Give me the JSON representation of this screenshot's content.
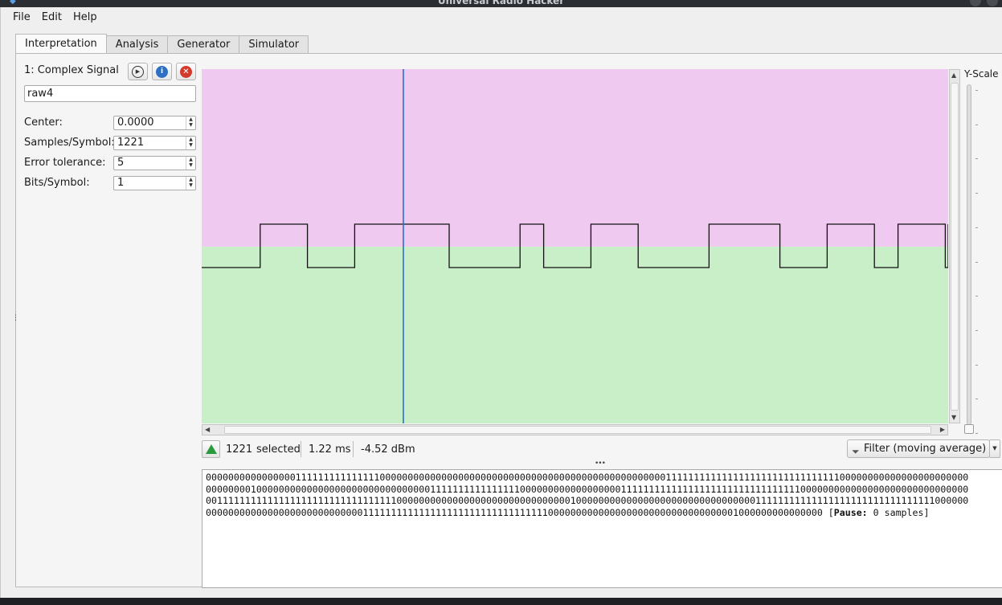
{
  "window": {
    "title": "Universal Radio Hacker"
  },
  "menu": {
    "file": "File",
    "edit": "Edit",
    "help": "Help"
  },
  "tabs": [
    {
      "label": "Interpretation",
      "active": true
    },
    {
      "label": "Analysis",
      "active": false
    },
    {
      "label": "Generator",
      "active": false
    },
    {
      "label": "Simulator",
      "active": false
    }
  ],
  "signal": {
    "title": "1:  Complex Signal",
    "name": "raw4",
    "center_label": "Center:",
    "center_value": "0.0000",
    "samples_label": "Samples/Symbol:",
    "samples_value": "1221",
    "tolerance_label": "Error tolerance:",
    "tolerance_value": "5",
    "bits_label": "Bits/Symbol:",
    "bits_value": "1",
    "buttons": [
      "play-icon",
      "info-icon",
      "close-icon"
    ]
  },
  "plot": {
    "upper_color": "#f0c9f0",
    "lower_color": "#c9efc9",
    "signal_color": "#111111",
    "cursor_color": "#2d6fc4",
    "y_scale_label": "Y-Scale"
  },
  "status": {
    "selected_count": "1221",
    "selected_label": "selected",
    "duration": "1.22 ms",
    "power": "-4.52 dBm",
    "filter_label": "Filter (moving average)"
  },
  "bits": {
    "lines": [
      "0000000000000000111111111111111000000000000000000000000000000000000000000000000000111111111111111111111111111111100000000000000000000000",
      "0000000010000000000000000000000000000000111111111111111100000000000000000011111111111111111111111111111111000000000000000000000000000000",
      "0011111111111111111111111111111111000000000000000000000000000000010000000000000000000000000000000011111111111111111111111111111111000000",
      "00000000000000000000000000001111111111111111111111111111111110000000000000000000000000000000001000000000000000"
    ],
    "pause_prefix": " [",
    "pause_label": "Pause:",
    "pause_value": " 0 samples]"
  }
}
